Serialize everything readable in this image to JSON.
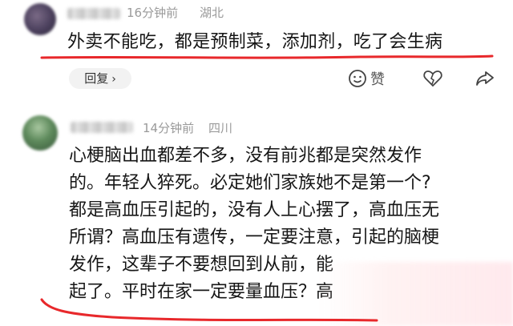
{
  "comments": [
    {
      "time": "16分钟前",
      "location": "湖北",
      "text": "外卖不能吃，都是预制菜，添加剂，吃了会生病",
      "reply_label": "回复",
      "like_label": "赞"
    },
    {
      "time": "14分钟前",
      "location": "四川",
      "lines": [
        "心梗脑出血都差不多，没有前兆都是突然发作",
        "的。年轻人猝死。必定她们家族她不是第一个?",
        "都是高血压引起的，没有人上心摆了，高血压无",
        "所谓？高血压有遗传，一定要注意，引起的脑梗",
        "发作，这辈子不要想回到从前，能",
        "起了。平时在家一定要量血压？高"
      ]
    }
  ],
  "annotation_color": "#e8282b"
}
